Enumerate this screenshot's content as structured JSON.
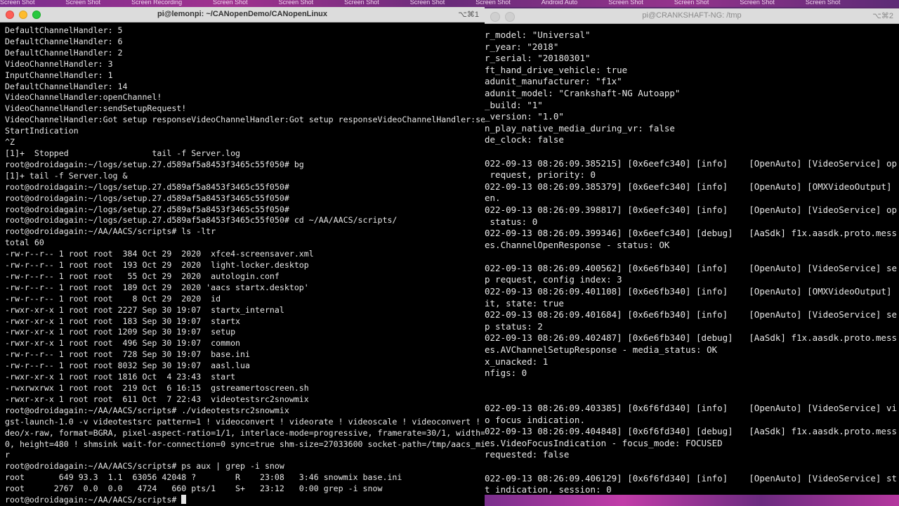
{
  "desktop": {
    "top_labels": [
      "Screen Shot",
      "Screen Shot",
      "Screen Recording",
      "Screen Shot",
      "Screen Shot",
      "Screen Shot",
      "Screen Shot",
      "Screen Shot",
      "Android Auto",
      "Screen Shot",
      "Screen Shot",
      "Screen Shot",
      "Screen Shot"
    ]
  },
  "left_window": {
    "title": "pi@lemonpi: ~/CANopenDemo/CANopenLinux",
    "shortcut": "⌥⌘1",
    "lines": [
      "DefaultChannelHandler: 5",
      "DefaultChannelHandler: 6",
      "DefaultChannelHandler: 2",
      "VideoChannelHandler: 3",
      "InputChannelHandler: 1",
      "DefaultChannelHandler: 14",
      "VideoChannelHandler:openChannel!",
      "VideoChannelHandler:sendSetupRequest!",
      "VideoChannelHandler:Got setup responseVideoChannelHandler:Got setup responseVideoChannelHandler:send",
      "StartIndication",
      "^Z",
      "[1]+  Stopped                 tail -f Server.log",
      "root@odroidagain:~/logs/setup.27.d589af5a8453f3465c55f050# bg",
      "[1]+ tail -f Server.log &",
      "root@odroidagain:~/logs/setup.27.d589af5a8453f3465c55f050#",
      "root@odroidagain:~/logs/setup.27.d589af5a8453f3465c55f050#",
      "root@odroidagain:~/logs/setup.27.d589af5a8453f3465c55f050#",
      "root@odroidagain:~/logs/setup.27.d589af5a8453f3465c55f050# cd ~/AA/AACS/scripts/",
      "root@odroidagain:~/AA/AACS/scripts# ls -ltr",
      "total 60",
      "-rw-r--r-- 1 root root  384 Oct 29  2020  xfce4-screensaver.xml",
      "-rw-r--r-- 1 root root  193 Oct 29  2020  light-locker.desktop",
      "-rw-r--r-- 1 root root   55 Oct 29  2020  autologin.conf",
      "-rw-r--r-- 1 root root  189 Oct 29  2020 'aacs startx.desktop'",
      "-rw-r--r-- 1 root root    8 Oct 29  2020  id",
      "-rwxr-xr-x 1 root root 2227 Sep 30 19:07  startx_internal",
      "-rwxr-xr-x 1 root root  183 Sep 30 19:07  startx",
      "-rwxr-xr-x 1 root root 1209 Sep 30 19:07  setup",
      "-rwxr-xr-x 1 root root  496 Sep 30 19:07  common",
      "-rw-r--r-- 1 root root  728 Sep 30 19:07  base.ini",
      "-rw-r--r-- 1 root root 8032 Sep 30 19:07  aasl.lua",
      "-rwxr-xr-x 1 root root 1816 Oct  4 23:43  start",
      "-rwxrwxrwx 1 root root  219 Oct  6 16:15  gstreamertoscreen.sh",
      "-rwxr-xr-x 1 root root  611 Oct  7 22:43  videotestsrc2snowmix",
      "root@odroidagain:~/AA/AACS/scripts# ./videotestsrc2snowmix",
      "gst-launch-1.0 -v videotestsrc pattern=1 ! videoconvert ! videorate ! videoscale ! videoconvert ! vi",
      "deo/x-raw, format=BGRA, pixel-aspect-ratio=1/1, interlace-mode=progressive, framerate=30/1, width=64",
      "0, height=480 ! shmsink wait-for-connection=0 sync=true shm-size=27033600 socket-path=/tmp/aacs_mixe",
      "r",
      "root@odroidagain:~/AA/AACS/scripts# ps aux | grep -i snow",
      "root       649 93.3  1.1  63056 42048 ?        R    23:08   3:46 snowmix base.ini",
      "root      2767  0.0  0.0   4724   660 pts/1    S+   23:12   0:00 grep -i snow",
      "root@odroidagain:~/AA/AACS/scripts# "
    ]
  },
  "right_window": {
    "title": "pi@CRANKSHAFT-NG: /tmp",
    "shortcut": "⌥⌘2",
    "lines": [
      "r_model: \"Universal\"",
      "r_year: \"2018\"",
      "r_serial: \"20180301\"",
      "ft_hand_drive_vehicle: true",
      "adunit_manufacturer: \"f1x\"",
      "adunit_model: \"Crankshaft-NG Autoapp\"",
      "_build: \"1\"",
      "_version: \"1.0\"",
      "n_play_native_media_during_vr: false",
      "de_clock: false",
      "",
      "022-09-13 08:26:09.385215] [0x6eefc340] [info]    [OpenAuto] [VideoService] op",
      " request, priority: 0",
      "022-09-13 08:26:09.385379] [0x6eefc340] [info]    [OpenAuto] [OMXVideoOutput]",
      "en.",
      "022-09-13 08:26:09.398817] [0x6eefc340] [info]    [OpenAuto] [VideoService] op",
      " status: 0",
      "022-09-13 08:26:09.399346] [0x6eefc340] [debug]   [AaSdk] f1x.aasdk.proto.mess",
      "es.ChannelOpenResponse - status: OK",
      "",
      "022-09-13 08:26:09.400562] [0x6e6fb340] [info]    [OpenAuto] [VideoService] se",
      "p request, config index: 3",
      "022-09-13 08:26:09.401108] [0x6e6fb340] [info]    [OpenAuto] [OMXVideoOutput]",
      "it, state: true",
      "022-09-13 08:26:09.401684] [0x6e6fb340] [info]    [OpenAuto] [VideoService] se",
      "p status: 2",
      "022-09-13 08:26:09.402487] [0x6e6fb340] [debug]   [AaSdk] f1x.aasdk.proto.mess",
      "es.AVChannelSetupResponse - media_status: OK",
      "x_unacked: 1",
      "nfigs: 0",
      "",
      "",
      "022-09-13 08:26:09.403385] [0x6f6fd340] [info]    [OpenAuto] [VideoService] vi",
      "o focus indication.",
      "022-09-13 08:26:09.404848] [0x6f6fd340] [debug]   [AaSdk] f1x.aasdk.proto.mess",
      "es.VideoFocusIndication - focus_mode: FOCUSED",
      "requested: false",
      "",
      "022-09-13 08:26:09.406129] [0x6f6fd340] [info]    [OpenAuto] [VideoService] st",
      "t indication, session: 0"
    ]
  }
}
